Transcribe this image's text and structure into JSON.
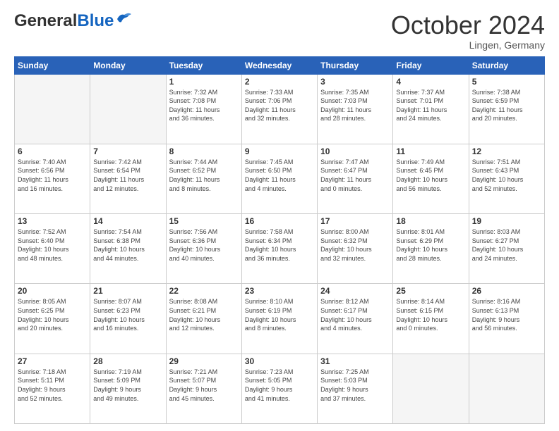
{
  "header": {
    "logo_general": "General",
    "logo_blue": "Blue",
    "month_title": "October 2024",
    "location": "Lingen, Germany"
  },
  "weekdays": [
    "Sunday",
    "Monday",
    "Tuesday",
    "Wednesday",
    "Thursday",
    "Friday",
    "Saturday"
  ],
  "weeks": [
    [
      {
        "day": "",
        "info": ""
      },
      {
        "day": "",
        "info": ""
      },
      {
        "day": "1",
        "info": "Sunrise: 7:32 AM\nSunset: 7:08 PM\nDaylight: 11 hours\nand 36 minutes."
      },
      {
        "day": "2",
        "info": "Sunrise: 7:33 AM\nSunset: 7:06 PM\nDaylight: 11 hours\nand 32 minutes."
      },
      {
        "day": "3",
        "info": "Sunrise: 7:35 AM\nSunset: 7:03 PM\nDaylight: 11 hours\nand 28 minutes."
      },
      {
        "day": "4",
        "info": "Sunrise: 7:37 AM\nSunset: 7:01 PM\nDaylight: 11 hours\nand 24 minutes."
      },
      {
        "day": "5",
        "info": "Sunrise: 7:38 AM\nSunset: 6:59 PM\nDaylight: 11 hours\nand 20 minutes."
      }
    ],
    [
      {
        "day": "6",
        "info": "Sunrise: 7:40 AM\nSunset: 6:56 PM\nDaylight: 11 hours\nand 16 minutes."
      },
      {
        "day": "7",
        "info": "Sunrise: 7:42 AM\nSunset: 6:54 PM\nDaylight: 11 hours\nand 12 minutes."
      },
      {
        "day": "8",
        "info": "Sunrise: 7:44 AM\nSunset: 6:52 PM\nDaylight: 11 hours\nand 8 minutes."
      },
      {
        "day": "9",
        "info": "Sunrise: 7:45 AM\nSunset: 6:50 PM\nDaylight: 11 hours\nand 4 minutes."
      },
      {
        "day": "10",
        "info": "Sunrise: 7:47 AM\nSunset: 6:47 PM\nDaylight: 11 hours\nand 0 minutes."
      },
      {
        "day": "11",
        "info": "Sunrise: 7:49 AM\nSunset: 6:45 PM\nDaylight: 10 hours\nand 56 minutes."
      },
      {
        "day": "12",
        "info": "Sunrise: 7:51 AM\nSunset: 6:43 PM\nDaylight: 10 hours\nand 52 minutes."
      }
    ],
    [
      {
        "day": "13",
        "info": "Sunrise: 7:52 AM\nSunset: 6:40 PM\nDaylight: 10 hours\nand 48 minutes."
      },
      {
        "day": "14",
        "info": "Sunrise: 7:54 AM\nSunset: 6:38 PM\nDaylight: 10 hours\nand 44 minutes."
      },
      {
        "day": "15",
        "info": "Sunrise: 7:56 AM\nSunset: 6:36 PM\nDaylight: 10 hours\nand 40 minutes."
      },
      {
        "day": "16",
        "info": "Sunrise: 7:58 AM\nSunset: 6:34 PM\nDaylight: 10 hours\nand 36 minutes."
      },
      {
        "day": "17",
        "info": "Sunrise: 8:00 AM\nSunset: 6:32 PM\nDaylight: 10 hours\nand 32 minutes."
      },
      {
        "day": "18",
        "info": "Sunrise: 8:01 AM\nSunset: 6:29 PM\nDaylight: 10 hours\nand 28 minutes."
      },
      {
        "day": "19",
        "info": "Sunrise: 8:03 AM\nSunset: 6:27 PM\nDaylight: 10 hours\nand 24 minutes."
      }
    ],
    [
      {
        "day": "20",
        "info": "Sunrise: 8:05 AM\nSunset: 6:25 PM\nDaylight: 10 hours\nand 20 minutes."
      },
      {
        "day": "21",
        "info": "Sunrise: 8:07 AM\nSunset: 6:23 PM\nDaylight: 10 hours\nand 16 minutes."
      },
      {
        "day": "22",
        "info": "Sunrise: 8:08 AM\nSunset: 6:21 PM\nDaylight: 10 hours\nand 12 minutes."
      },
      {
        "day": "23",
        "info": "Sunrise: 8:10 AM\nSunset: 6:19 PM\nDaylight: 10 hours\nand 8 minutes."
      },
      {
        "day": "24",
        "info": "Sunrise: 8:12 AM\nSunset: 6:17 PM\nDaylight: 10 hours\nand 4 minutes."
      },
      {
        "day": "25",
        "info": "Sunrise: 8:14 AM\nSunset: 6:15 PM\nDaylight: 10 hours\nand 0 minutes."
      },
      {
        "day": "26",
        "info": "Sunrise: 8:16 AM\nSunset: 6:13 PM\nDaylight: 9 hours\nand 56 minutes."
      }
    ],
    [
      {
        "day": "27",
        "info": "Sunrise: 7:18 AM\nSunset: 5:11 PM\nDaylight: 9 hours\nand 52 minutes."
      },
      {
        "day": "28",
        "info": "Sunrise: 7:19 AM\nSunset: 5:09 PM\nDaylight: 9 hours\nand 49 minutes."
      },
      {
        "day": "29",
        "info": "Sunrise: 7:21 AM\nSunset: 5:07 PM\nDaylight: 9 hours\nand 45 minutes."
      },
      {
        "day": "30",
        "info": "Sunrise: 7:23 AM\nSunset: 5:05 PM\nDaylight: 9 hours\nand 41 minutes."
      },
      {
        "day": "31",
        "info": "Sunrise: 7:25 AM\nSunset: 5:03 PM\nDaylight: 9 hours\nand 37 minutes."
      },
      {
        "day": "",
        "info": ""
      },
      {
        "day": "",
        "info": ""
      }
    ]
  ]
}
